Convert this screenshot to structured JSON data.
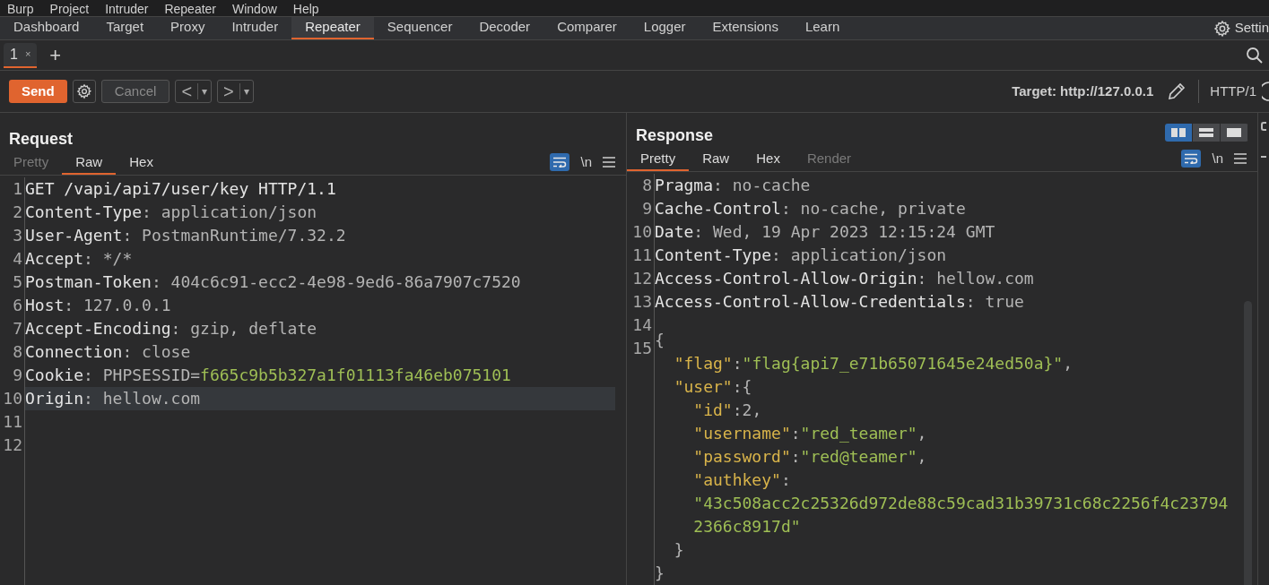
{
  "menu_bar": [
    "Burp",
    "Project",
    "Intruder",
    "Repeater",
    "Window",
    "Help"
  ],
  "main_tabs": [
    {
      "label": "Dashboard",
      "selected": false
    },
    {
      "label": "Target",
      "selected": false
    },
    {
      "label": "Proxy",
      "selected": false
    },
    {
      "label": "Intruder",
      "selected": false
    },
    {
      "label": "Repeater",
      "selected": true
    },
    {
      "label": "Sequencer",
      "selected": false
    },
    {
      "label": "Decoder",
      "selected": false
    },
    {
      "label": "Comparer",
      "selected": false
    },
    {
      "label": "Logger",
      "selected": false
    },
    {
      "label": "Extensions",
      "selected": false
    },
    {
      "label": "Learn",
      "selected": false
    }
  ],
  "settings_label": "Settin",
  "repeater_tabs": [
    {
      "label": "1",
      "close": "×",
      "selected": true
    }
  ],
  "new_tab": "+",
  "toolbar": {
    "send": "Send",
    "cancel": {
      "label": "Cancel",
      "disabled": true
    },
    "back": "<",
    "back_menu": "▾",
    "forward": ">",
    "forward_menu": "▾",
    "target": "Target: http://127.0.0.1",
    "protocol": "HTTP/1"
  },
  "layout_buttons": [
    {
      "kind": "columns",
      "selected": true
    },
    {
      "kind": "rows",
      "selected": false
    },
    {
      "kind": "single",
      "selected": false
    }
  ],
  "request": {
    "title": "Request",
    "tabs": [
      {
        "label": "Pretty",
        "selected": false,
        "disabled": true
      },
      {
        "label": "Raw",
        "selected": true,
        "disabled": false
      },
      {
        "label": "Hex",
        "selected": false,
        "disabled": false
      }
    ],
    "wrap_on": true,
    "newline_toggle": "\\n",
    "lines": [
      {
        "number": "1",
        "highlighted": false,
        "tokens": [
          {
            "text": "GET /vapi/api7/user/key HTTP/1.1",
            "kind": "name"
          }
        ]
      },
      {
        "number": "2",
        "highlighted": false,
        "tokens": [
          {
            "text": "Content-Type",
            "kind": "name"
          },
          {
            "text": ": application/json",
            "kind": "value"
          }
        ]
      },
      {
        "number": "3",
        "highlighted": false,
        "tokens": [
          {
            "text": "User-Agent",
            "kind": "name"
          },
          {
            "text": ": PostmanRuntime/7.32.2",
            "kind": "value"
          }
        ]
      },
      {
        "number": "4",
        "highlighted": false,
        "tokens": [
          {
            "text": "Accept",
            "kind": "name"
          },
          {
            "text": ": */*",
            "kind": "value"
          }
        ]
      },
      {
        "number": "5",
        "highlighted": false,
        "tokens": [
          {
            "text": "Postman-Token",
            "kind": "name"
          },
          {
            "text": ": 404c6c91-ecc2-4e98-9ed6-86a7907c7520",
            "kind": "value"
          }
        ]
      },
      {
        "number": "6",
        "highlighted": false,
        "tokens": [
          {
            "text": "Host",
            "kind": "name"
          },
          {
            "text": ": 127.0.0.1",
            "kind": "value"
          }
        ]
      },
      {
        "number": "7",
        "highlighted": false,
        "tokens": [
          {
            "text": "Accept-Encoding",
            "kind": "name"
          },
          {
            "text": ": gzip, deflate",
            "kind": "value"
          }
        ]
      },
      {
        "number": "8",
        "highlighted": false,
        "tokens": [
          {
            "text": "Connection",
            "kind": "name"
          },
          {
            "text": ": close",
            "kind": "value"
          }
        ]
      },
      {
        "number": "9",
        "highlighted": false,
        "tokens": [
          {
            "text": "Cookie",
            "kind": "name"
          },
          {
            "text": ": PHPSESSID=",
            "kind": "value"
          },
          {
            "text": "f665c9b5b327a1f01113fa46eb075101",
            "kind": "string"
          }
        ]
      },
      {
        "number": "10",
        "highlighted": true,
        "tokens": [
          {
            "text": "Origin",
            "kind": "name"
          },
          {
            "text": ": hellow.com",
            "kind": "value"
          }
        ]
      },
      {
        "number": "11",
        "highlighted": false
      },
      {
        "number": "12",
        "highlighted": false
      }
    ]
  },
  "response": {
    "title": "Response",
    "tabs": [
      {
        "label": "Pretty",
        "selected": true,
        "disabled": false
      },
      {
        "label": "Raw",
        "selected": false,
        "disabled": false
      },
      {
        "label": "Hex",
        "selected": false,
        "disabled": false
      },
      {
        "label": "Render",
        "selected": false,
        "disabled": true
      }
    ],
    "wrap_on": true,
    "newline_toggle": "\\n",
    "lines": [
      {
        "number": "8",
        "highlighted": false,
        "tokens": [
          {
            "text": "Pragma",
            "kind": "name"
          },
          {
            "text": ": no-cache",
            "kind": "value"
          }
        ]
      },
      {
        "number": "9",
        "highlighted": false,
        "tokens": [
          {
            "text": "Cache-Control",
            "kind": "name"
          },
          {
            "text": ": no-cache, private",
            "kind": "value"
          }
        ]
      },
      {
        "number": "10",
        "highlighted": false,
        "tokens": [
          {
            "text": "Date",
            "kind": "name"
          },
          {
            "text": ": Wed, 19 Apr 2023 12:15:24 GMT",
            "kind": "value"
          }
        ]
      },
      {
        "number": "11",
        "highlighted": false,
        "tokens": [
          {
            "text": "Content-Type",
            "kind": "name"
          },
          {
            "text": ": application/json",
            "kind": "value"
          }
        ]
      },
      {
        "number": "12",
        "highlighted": false,
        "tokens": [
          {
            "text": "Access-Control-Allow-Origin",
            "kind": "name"
          },
          {
            "text": ": hellow.com",
            "kind": "value"
          }
        ]
      },
      {
        "number": "13",
        "highlighted": false,
        "tokens": [
          {
            "text": "Access-Control-Allow-Credentials",
            "kind": "name"
          },
          {
            "text": ": true",
            "kind": "value"
          }
        ]
      },
      {
        "number": "14",
        "highlighted": false
      },
      {
        "number": "15",
        "highlighted": false,
        "tokens": [
          {
            "text": "{",
            "kind": "value"
          }
        ]
      },
      {
        "highlighted": false,
        "tokens": [
          {
            "text": "  \"flag\"",
            "kind": "key"
          },
          {
            "text": ":",
            "kind": "value"
          },
          {
            "text": "\"flag{api7_e71b65071645e24ed50a}\"",
            "kind": "string"
          },
          {
            "text": ",",
            "kind": "value"
          }
        ]
      },
      {
        "highlighted": false,
        "tokens": [
          {
            "text": "  \"user\"",
            "kind": "key"
          },
          {
            "text": ":{",
            "kind": "value"
          }
        ]
      },
      {
        "highlighted": false,
        "tokens": [
          {
            "text": "    \"id\"",
            "kind": "key"
          },
          {
            "text": ":2,",
            "kind": "value"
          }
        ]
      },
      {
        "highlighted": false,
        "tokens": [
          {
            "text": "    \"username\"",
            "kind": "key"
          },
          {
            "text": ":",
            "kind": "value"
          },
          {
            "text": "\"red_teamer\"",
            "kind": "string"
          },
          {
            "text": ",",
            "kind": "value"
          }
        ]
      },
      {
        "highlighted": false,
        "tokens": [
          {
            "text": "    \"password\"",
            "kind": "key"
          },
          {
            "text": ":",
            "kind": "value"
          },
          {
            "text": "\"red@teamer\"",
            "kind": "string"
          },
          {
            "text": ",",
            "kind": "value"
          }
        ]
      },
      {
        "highlighted": false,
        "tokens": [
          {
            "text": "    \"authkey\"",
            "kind": "key"
          },
          {
            "text": ":",
            "kind": "value"
          }
        ]
      },
      {
        "highlighted": false,
        "tokens": [
          {
            "text": "    \"43c508acc2c25326d972de88c59cad31b39731c68c2256f4c23794",
            "kind": "string"
          }
        ]
      },
      {
        "highlighted": false,
        "tokens": [
          {
            "text": "    2366c8917d\"",
            "kind": "string"
          }
        ]
      },
      {
        "highlighted": false,
        "tokens": [
          {
            "text": "  }",
            "kind": "value"
          }
        ]
      },
      {
        "highlighted": false,
        "tokens": [
          {
            "text": "}",
            "kind": "value"
          }
        ]
      }
    ]
  }
}
